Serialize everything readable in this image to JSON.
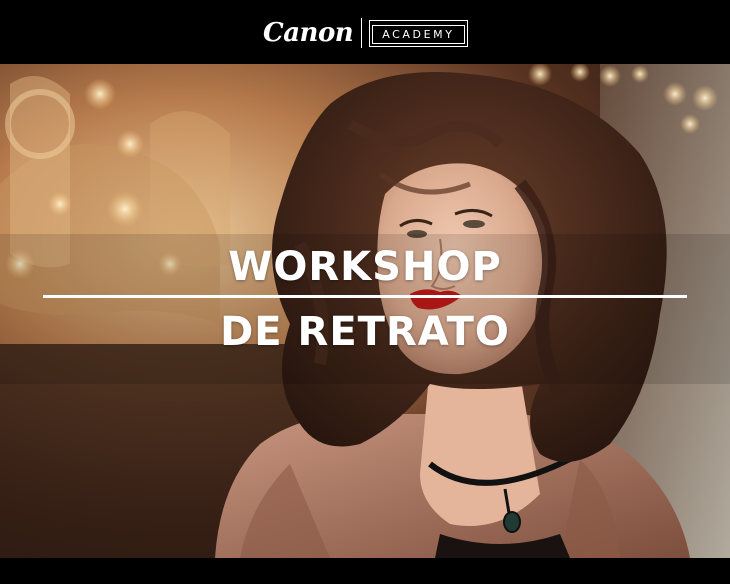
{
  "header": {
    "brand": "Canon",
    "sub_brand": "ACADEMY"
  },
  "headline": {
    "line1": "WORKSHOP",
    "line2": "DE RETRATO"
  },
  "photo": {
    "description_icon": "portrait-photo",
    "colors": {
      "bokeh_warm": "#d8a060",
      "hair": "#4a2c1e",
      "lips": "#c01a1a",
      "coat": "#b07a62"
    }
  }
}
